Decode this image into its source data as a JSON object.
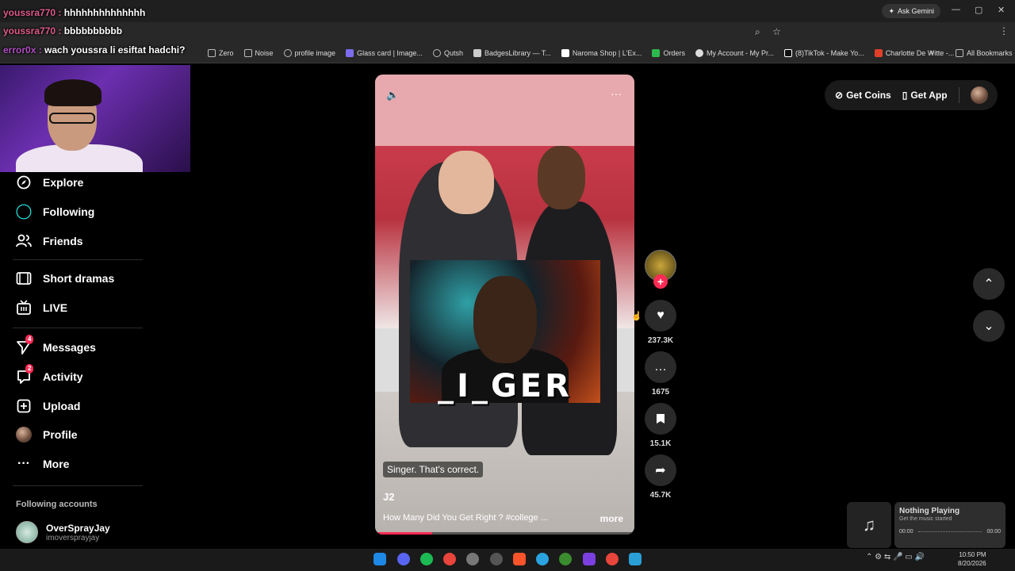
{
  "browser": {
    "ask_gemini": "Ask Gemini",
    "window_controls": [
      "—",
      "▢",
      "✕"
    ],
    "bookmarks": [
      {
        "label": "Zero",
        "color": "#bbb"
      },
      {
        "label": "Noise",
        "color": "#bbb"
      },
      {
        "label": "profile image",
        "color": "#bbb"
      },
      {
        "label": "Glass card | Image...",
        "color": "#7b6cf0"
      },
      {
        "label": "Qutsh",
        "color": "#bbb"
      },
      {
        "label": "BadgesLibrary — T...",
        "color": "#ccc"
      },
      {
        "label": "Naroma Shop | L'Ex...",
        "color": "#fff"
      },
      {
        "label": "Orders",
        "color": "#2db84d"
      },
      {
        "label": "My Account - My Pr...",
        "color": "#ddd"
      },
      {
        "label": "(8)TikTok - Make Yo...",
        "color": "#fff"
      },
      {
        "label": "Charlotte De Witte -...",
        "color": "#e0402a"
      }
    ],
    "all_bookmarks": "All Bookmarks"
  },
  "chat": [
    {
      "user": "youssra770",
      "sep": " : ",
      "message": "hhhhhhhhhhhhhh"
    },
    {
      "user": "youssra770",
      "sep": " : ",
      "message": "bbbbbbbbbb"
    },
    {
      "user": "error0x",
      "sep": " : ",
      "message": "wach youssra li esiftat hadchi?"
    }
  ],
  "sidebar": {
    "items": [
      {
        "label": "Explore",
        "icon": "compass-icon"
      },
      {
        "label": "Following",
        "icon": "following-icon"
      },
      {
        "label": "Friends",
        "icon": "friends-icon"
      },
      {
        "label": "Short dramas",
        "icon": "film-icon"
      },
      {
        "label": "LIVE",
        "icon": "live-icon"
      },
      {
        "label": "Messages",
        "icon": "messages-icon",
        "badge": "4"
      },
      {
        "label": "Activity",
        "icon": "activity-icon",
        "badge": "2"
      },
      {
        "label": "Upload",
        "icon": "upload-icon"
      },
      {
        "label": "Profile",
        "icon": "profile-avatar"
      },
      {
        "label": "More",
        "icon": "more-icon"
      }
    ],
    "following_header": "Following accounts",
    "account": {
      "name": "OverSprayJay",
      "handle": "imoversprayjay"
    }
  },
  "video": {
    "overlay_text": "_I_GER",
    "caption": "Singer. That's correct.",
    "author": "J2",
    "description": "How Many Did You Get Right ? #college ...",
    "more": "more",
    "progress": 0.22
  },
  "actions": {
    "likes": "237.3K",
    "comments": "1675",
    "saves": "15.1K",
    "shares": "45.7K"
  },
  "topright": {
    "get_coins": "Get Coins",
    "get_app": "Get App"
  },
  "music": {
    "title": "Nothing Playing",
    "subtitle": "Get the music started",
    "time_start": "00:00",
    "time_end": "00:00"
  },
  "taskbar": {
    "time": "10:50 PM",
    "date": "8/20/2026"
  },
  "colors": {
    "accent": "#fe2c55",
    "following_ring": "#25f4ee"
  }
}
